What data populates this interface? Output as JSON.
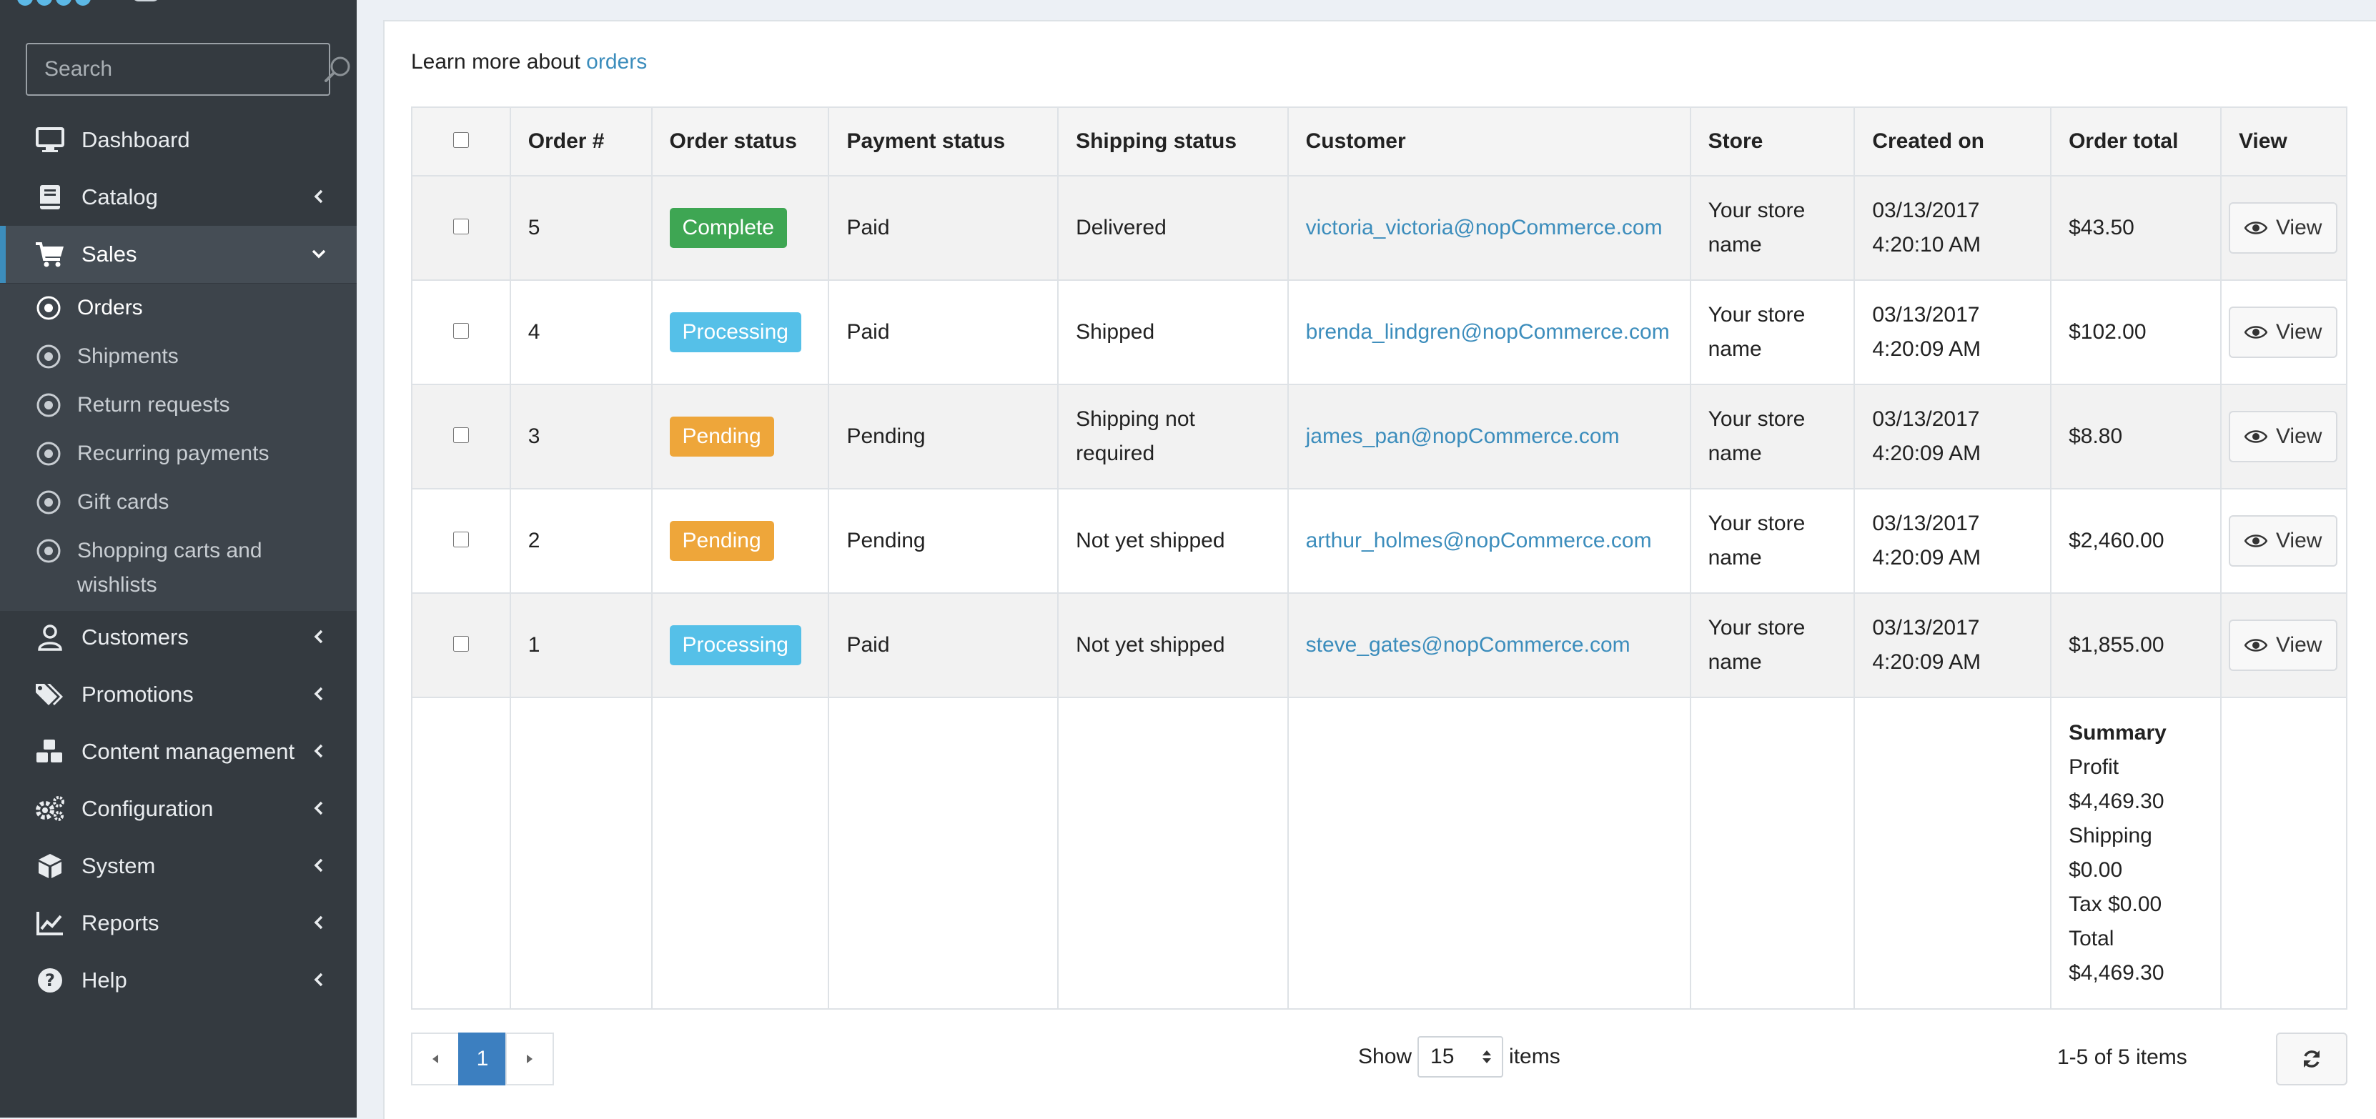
{
  "sidebar": {
    "search_placeholder": "Search",
    "items": [
      {
        "label": "Dashboard",
        "icon": "monitor-icon"
      },
      {
        "label": "Catalog",
        "icon": "book-icon"
      },
      {
        "label": "Sales",
        "icon": "cart-icon"
      },
      {
        "label": "Customers",
        "icon": "user-icon"
      },
      {
        "label": "Promotions",
        "icon": "tags-icon"
      },
      {
        "label": "Content management",
        "icon": "cubes-icon"
      },
      {
        "label": "Configuration",
        "icon": "gears-icon"
      },
      {
        "label": "System",
        "icon": "cube-icon"
      },
      {
        "label": "Reports",
        "icon": "chart-line-icon"
      },
      {
        "label": "Help",
        "icon": "question-circle-icon"
      }
    ],
    "sales_sub": [
      {
        "label": "Orders"
      },
      {
        "label": "Shipments"
      },
      {
        "label": "Return requests"
      },
      {
        "label": "Recurring payments"
      },
      {
        "label": "Gift cards"
      },
      {
        "label": "Shopping carts and wishlists"
      }
    ]
  },
  "learn": {
    "prefix": "Learn more about",
    "link": "orders"
  },
  "table": {
    "headers": [
      "Order #",
      "Order status",
      "Payment status",
      "Shipping status",
      "Customer",
      "Store",
      "Created on",
      "Order total",
      "View"
    ],
    "rows": [
      {
        "order": "5",
        "status": "Complete",
        "payment": "Paid",
        "shipping": "Delivered",
        "customer": "victoria_victoria@nopCommerce.com",
        "store": "Your store name",
        "created": "03/13/2017 4:20:10 AM",
        "total": "$43.50",
        "view": "View"
      },
      {
        "order": "4",
        "status": "Processing",
        "payment": "Paid",
        "shipping": "Shipped",
        "customer": "brenda_lindgren@nopCommerce.com",
        "store": "Your store name",
        "created": "03/13/2017 4:20:09 AM",
        "total": "$102.00",
        "view": "View"
      },
      {
        "order": "3",
        "status": "Pending",
        "payment": "Pending",
        "shipping": "Shipping not required",
        "customer": "james_pan@nopCommerce.com",
        "store": "Your store name",
        "created": "03/13/2017 4:20:09 AM",
        "total": "$8.80",
        "view": "View"
      },
      {
        "order": "2",
        "status": "Pending",
        "payment": "Pending",
        "shipping": "Not yet shipped",
        "customer": "arthur_holmes@nopCommerce.com",
        "store": "Your store name",
        "created": "03/13/2017 4:20:09 AM",
        "total": "$2,460.00",
        "view": "View"
      },
      {
        "order": "1",
        "status": "Processing",
        "payment": "Paid",
        "shipping": "Not yet shipped",
        "customer": "steve_gates@nopCommerce.com",
        "store": "Your store name",
        "created": "03/13/2017 4:20:09 AM",
        "total": "$1,855.00",
        "view": "View"
      }
    ],
    "summary": {
      "title": "Summary",
      "profit_label": "Profit",
      "profit": "$4,469.30",
      "shipping_label": "Shipping",
      "shipping": "$0.00",
      "tax": "Tax $0.00",
      "total_label": "Total",
      "total": "$4,469.30"
    }
  },
  "status_colors": {
    "Complete": "#3ea653",
    "Processing": "#55c0e8",
    "Pending": "#eea63a"
  },
  "pager": {
    "current": "1",
    "show_label": "Show",
    "page_size": "15",
    "items_label": "items",
    "range": "1-5 of 5 items"
  }
}
